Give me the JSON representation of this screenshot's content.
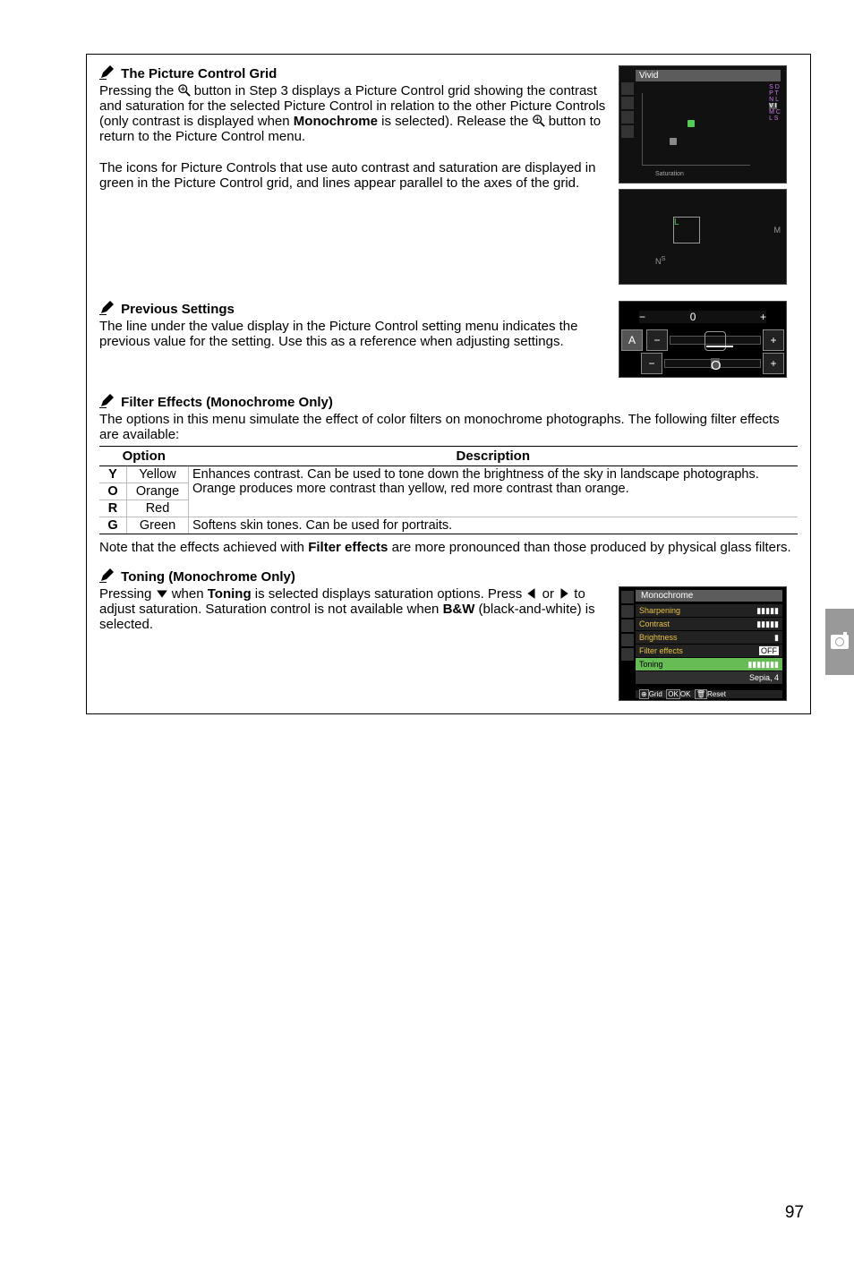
{
  "sections": {
    "grid": {
      "title": "The Picture Control Grid",
      "p1_a": "Pressing the ",
      "p1_b": " button in Step 3 displays a Picture Control grid showing the contrast and saturation for the selected Picture Control in relation to the other Picture Controls (only contrast is displayed when ",
      "p1_c": " is selected).  Release the ",
      "p1_d": " button to return to the Picture Control menu.",
      "mono": "Monochrome",
      "p2": "The icons for Picture Controls that use auto contrast and saturation are displayed in green in the Picture Control grid, and lines appear parallel to the axes of the grid."
    },
    "prev": {
      "title": "Previous Settings",
      "body": "The line under the value display in the Picture Control setting menu indicates the previous value for the setting.  Use this as a reference when adjusting settings."
    },
    "filter": {
      "title": "Filter Effects (Monochrome Only)",
      "intro": "The options in this menu simulate the effect of color filters on monochrome photographs.  The following filter effects are available:",
      "headers": {
        "option": "Option",
        "desc": "Description"
      },
      "rows": [
        {
          "code": "Y",
          "name": "Yellow"
        },
        {
          "code": "O",
          "name": "Orange"
        },
        {
          "code": "R",
          "name": "Red"
        },
        {
          "code": "G",
          "name": "Green",
          "desc": "Softens skin tones.  Can be used for portraits."
        }
      ],
      "desc_yor": "Enhances contrast.  Can be used to tone down the brightness of the sky in landscape photographs.  Orange produces more contrast than yellow, red more contrast than orange.",
      "note_a": "Note that the effects achieved with ",
      "note_b": " are more pronounced than those produced by physical glass filters.",
      "filter_label": "Filter effects"
    },
    "toning": {
      "title": "Toning (Monochrome Only)",
      "p_a": "Pressing ",
      "p_b": " when ",
      "p_c": " is selected displays saturation options.  Press ",
      "p_d": " or ",
      "p_e": " to adjust saturation.  Saturation control is not available when ",
      "p_f": " (black-and-white) is selected.",
      "toning_label": "Toning",
      "bw_label": "B&W"
    }
  },
  "grid_thumb": {
    "title": "Vivid",
    "xaxis": "Saturation",
    "side_letters": [
      "SD",
      "PT",
      "NL",
      "VI",
      "MC",
      "LS"
    ]
  },
  "slider_letters": {
    "A": "A",
    "zero": "O",
    "arrow": "0"
  },
  "menu_thumb": {
    "title": "Monochrome",
    "items": [
      {
        "label": "Sharpening",
        "value": ""
      },
      {
        "label": "Contrast",
        "value": ""
      },
      {
        "label": "Brightness",
        "value": ""
      },
      {
        "label": "Filter effects",
        "value": "OFF"
      },
      {
        "label": "Toning",
        "value": ""
      }
    ],
    "sepia": "Sepia, 4",
    "footer_grid": "Grid",
    "footer_ok": "OK",
    "footer_reset": "Reset"
  },
  "page_number": "97"
}
